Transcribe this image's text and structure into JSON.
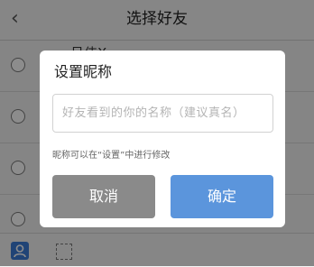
{
  "header": {
    "back_icon": "chevron-left-icon",
    "title": "选择好友"
  },
  "list": {
    "first_row_name": "吕伟X"
  },
  "dialog": {
    "title": "设置昵称",
    "input_placeholder": "好友看到的你的名称（建议真名）",
    "input_value": "",
    "hint": "昵称可以在“设置”中进行修改",
    "cancel_label": "取消",
    "confirm_label": "确定"
  },
  "colors": {
    "cancel_button": "#8a8a8a",
    "confirm_button": "#5b95dc",
    "contact_icon": "#3b7dd8"
  }
}
